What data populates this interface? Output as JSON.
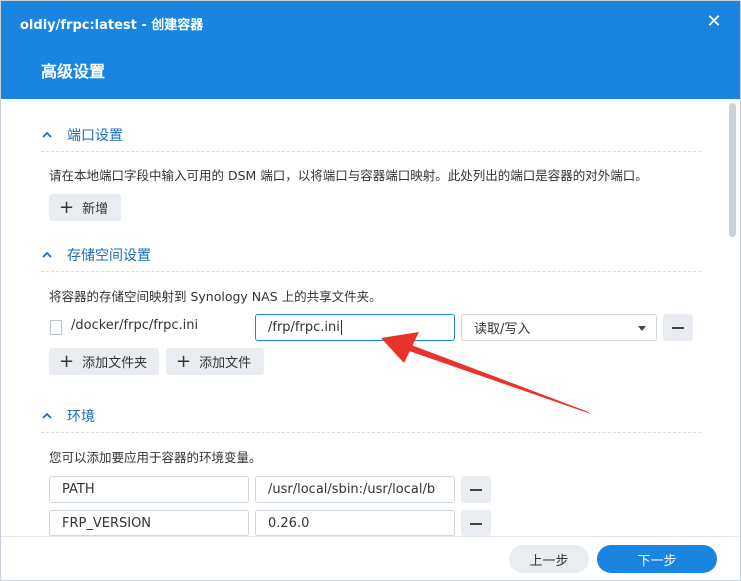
{
  "window": {
    "title": "oldiy/frpc:latest - 创建容器",
    "heading": "高级设置"
  },
  "ports": {
    "header": "端口设置",
    "description": "请在本地端口字段中输入可用的 DSM 端口，以将端口与容器端口映射。此处列出的端口是容器的对外端口。",
    "add_label": "新增"
  },
  "storage": {
    "header": "存储空间设置",
    "description": "将容器的存储空间映射到 Synology NAS 上的共享文件夹。",
    "rows": [
      {
        "host_path": "/docker/frpc/frpc.ini",
        "mount_path": "/frp/frpc.ini",
        "permission": "读取/写入"
      }
    ],
    "add_folder_label": "添加文件夹",
    "add_file_label": "添加文件"
  },
  "environment": {
    "header": "环境",
    "description": "您可以添加要应用于容器的环境变量。",
    "variables": [
      {
        "name": "PATH",
        "value": "/usr/local/sbin:/usr/local/b"
      },
      {
        "name": "FRP_VERSION",
        "value": "0.26.0"
      }
    ]
  },
  "footer": {
    "prev_label": "上一步",
    "next_label": "下一步"
  },
  "colors": {
    "header_blue": "#1a85e0",
    "link_blue": "#1a6cc2",
    "annotation_red": "#e8332a"
  },
  "icons": {
    "close": "close-icon",
    "chevron": "chevron-up-icon",
    "plus": "plus-icon",
    "minus": "minus-icon",
    "file": "file-icon",
    "dropdown": "caret-down-icon",
    "annotation": "red-arrow-icon"
  }
}
